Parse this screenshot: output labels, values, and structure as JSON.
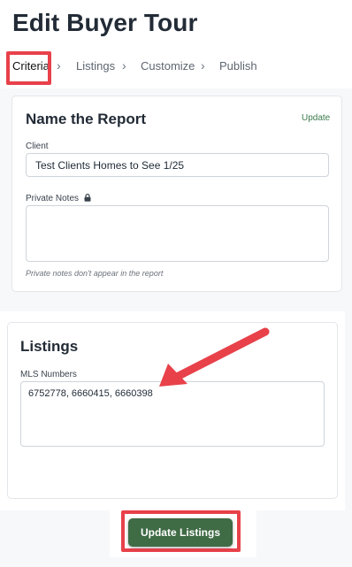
{
  "page": {
    "title": "Edit Buyer Tour"
  },
  "steps": [
    {
      "label": "Criteria",
      "active": true
    },
    {
      "label": "Listings",
      "active": false
    },
    {
      "label": "Customize",
      "active": false
    },
    {
      "label": "Publish",
      "active": false
    }
  ],
  "step_separator": "›",
  "report_card": {
    "title": "Name the Report",
    "update_link": "Update",
    "client_label": "Client",
    "client_value": "Test Clients Homes to See 1/25",
    "notes_label": "Private Notes",
    "notes_value": "",
    "notes_hint": "Private notes don't appear in the report"
  },
  "listings_card": {
    "title": "Listings",
    "mls_label": "MLS Numbers",
    "mls_value": "6752778, 6660415, 6660398"
  },
  "footer": {
    "update_button": "Update Listings"
  },
  "colors": {
    "highlight": "#e8414a",
    "primary_button": "#3f6b45",
    "link": "#3c7a4e"
  },
  "icons": {
    "notes_lock": "lock-icon",
    "annotation_arrow": "arrow-annotation"
  }
}
